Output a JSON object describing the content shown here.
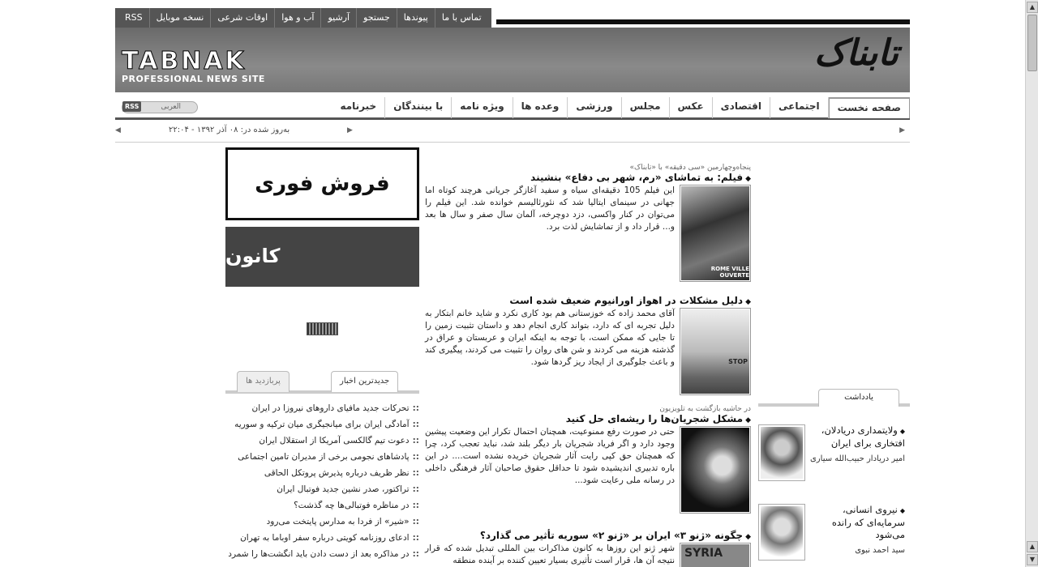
{
  "top_links": [
    "تماس با ما",
    "پیوندها",
    "جستجو",
    "آرشیو",
    "آب و هوا",
    "اوقات شرعی",
    "نسخه موبایل",
    "RSS"
  ],
  "brand": {
    "en_logo": "TABNAK",
    "en_tagline": "PROFESSIONAL NEWS SITE",
    "fa_logo": "تابناک"
  },
  "nav": {
    "items": [
      "صفحه نخست",
      "اجتماعی",
      "اقتصادی",
      "عکس",
      "مجلس",
      "ورزشی",
      "وعده ها",
      "ویژه نامه",
      "با بینندگان",
      "خبرنامه"
    ],
    "active": "صفحه نخست",
    "rss_badge": "RSS",
    "arabic_link": "العربی"
  },
  "updated": "به‌روز شده در: ۰۸ آذر ۱۳۹۲ - ۲۲:۰۴",
  "ads": {
    "ad1_text": "فروش فوری",
    "ad2_text": "کانون"
  },
  "news_tabs": {
    "latest": "جدیدترین اخبار",
    "most_viewed": "پربازدید ها"
  },
  "latest_news": [
    "تحرکات جدید مافیای داروهای نیروزا در ایران",
    "آمادگی ایران برای میانجیگری میان ترکیه و سوریه",
    "دعوت تیم گالکسی آمریکا از استقلال ایران",
    "پادشاهای نجومی برخی از مدیران تامین اجتماعی",
    "نظر ظریف درباره پذیرش پروتکل الحاقی",
    "تراکتور، صدر نشین جدید فوتبال ایران",
    "در مناظره فوتبالی‌ها چه گذشت؟",
    "«شیر» از فردا به مدارس پایتخت می‌رود",
    "ادعای روزنامه کویتی درباره سفر اوباما به تهران",
    "در مذاکره بعد از دست دادن باید انگشت‌ها را شمرد"
  ],
  "articles": [
    {
      "pre": "پنجاه‌وچهارمین «سی دقیقه» با «تابناک»",
      "title": "فیلم: به تماشای «رم، شهر بی دفاع» بنشیند",
      "body": "این فیلم 105 دقیقه‌ای سیاه و سفید آغازگر جریانی هرچند کوتاه اما جهانی در سینمای ایتالیا شد که نئورئالیسم خوانده شد. این فیلم را می‌توان در کنار واکسی، دزد دوچرخه، آلمان سال صفر و سال ها بعد و... قرار داد و از تماشایش لذت برد.",
      "image_caption": "ROME VILLE OUVERTE"
    },
    {
      "pre": "",
      "title": "دلیل مشکلات در اهواز اورانیوم ضعیف شده است",
      "body": "آقای محمد زاده که خوزستانی هم بود کاری نکرد و شاید خانم ابتکار به دلیل تجربه ای که دارد، بتواند کاری انجام دهد و داستان تثبیت زمین را تا جایی که ممکن است، با توجه به اینکه ایران و عربستان و عراق در گذشته هزینه می کردند و شن های روان را تثبیت می کردند، پیگیری کند و باعث جلوگیری از ایجاد ریز گردها شود.",
      "image_caption": "STOP"
    },
    {
      "pre": "در حاشیه بازگشت به تلویزیون",
      "title": "مشکل شجریان‌ها را ریشه‌ای حل کنید",
      "body": "حتی در صورت رفع ممنوعیت، همچنان احتمال تکرار این وضعیت پیشین وجود دارد و اگر فریاد شجریان بار دیگر بلند شد، نباید تعجب کرد، چرا که همچنان حق کپی رایت آثار شجریان خریده نشده است.... در این باره تدبیری اندیشیده شود تا حداقل حقوق صاحبان آثار فرهنگی داخلی در رسانه ملی رعایت شود...",
      "image_caption": ""
    },
    {
      "pre": "",
      "title": "چگونه «ژنو ۳» ایران بر «ژنو ۲» سوریه تأثیر می گذارد؟",
      "body": "شهر ژنو این روزها به کانون مذاکرات بین المللی تبدیل شده که قرار نتیجه آن ها، قرار است تأثیری بسیار تعیین کننده بر آینده منطقه",
      "image_caption": "SYRIA"
    }
  ],
  "notes_tab": "یادداشت",
  "notes": [
    {
      "title": "ولایتمداری دریادلان، افتخاری برای ایران",
      "author": "امیر دریادار حبیب‌الله سیاری"
    },
    {
      "title": "نیروی انسانی، سرمایه‌ای که رانده می‌شود",
      "author": "سید احمد نبوی"
    }
  ]
}
